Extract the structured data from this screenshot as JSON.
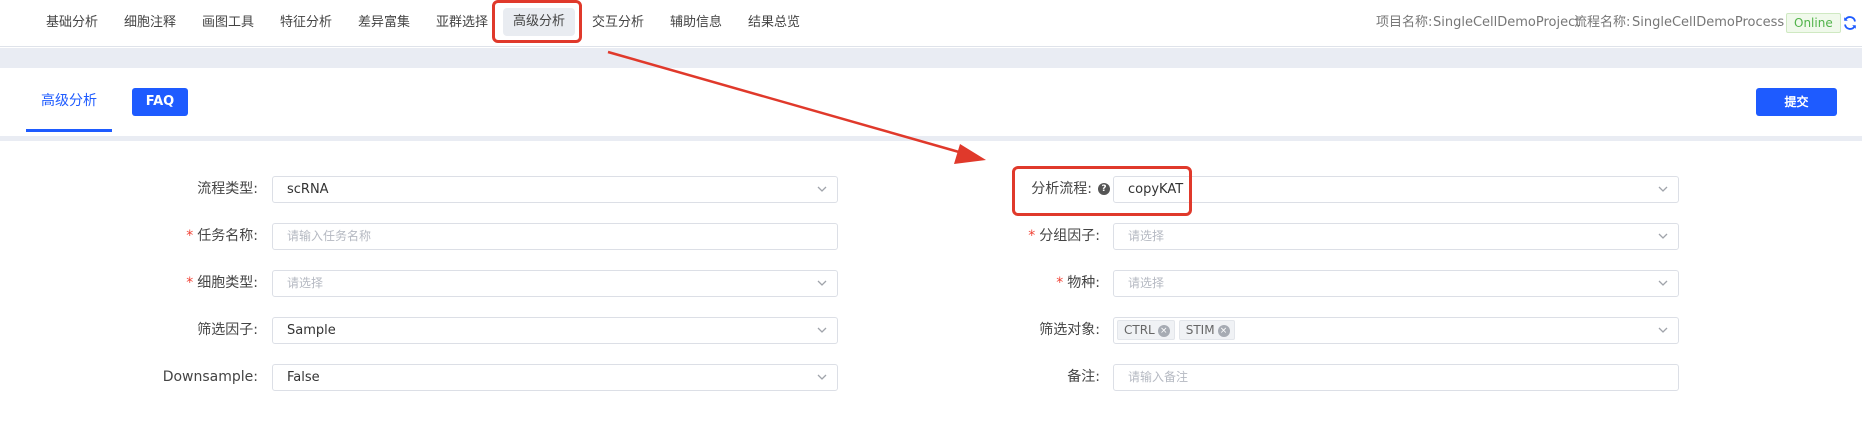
{
  "nav": {
    "items": [
      "基础分析",
      "细胞注释",
      "画图工具",
      "特征分析",
      "差异富集",
      "亚群选择",
      "高级分析",
      "交互分析",
      "辅助信息",
      "结果总览"
    ],
    "project_label": "项目名称:",
    "project_value": "SingleCellDemoProject",
    "process_label": "流程名称:",
    "process_value": "SingleCellDemoProcess",
    "status": "Online",
    "refresh_icon": "refresh-icon"
  },
  "tabs": {
    "active": "高级分析",
    "faq": "FAQ",
    "submit": "提交"
  },
  "form": {
    "left": [
      {
        "label": "流程类型:",
        "required": false,
        "value": "scRNA",
        "placeholder": "",
        "type": "select"
      },
      {
        "label": "任务名称:",
        "required": true,
        "value": "",
        "placeholder": "请输入任务名称",
        "type": "input"
      },
      {
        "label": "细胞类型:",
        "required": true,
        "value": "",
        "placeholder": "请选择",
        "type": "select"
      },
      {
        "label": "筛选因子:",
        "required": false,
        "value": "Sample",
        "placeholder": "",
        "type": "select"
      },
      {
        "label": "Downsample:",
        "required": false,
        "value": "False",
        "placeholder": "",
        "type": "select"
      }
    ],
    "right": [
      {
        "label": "分析流程:",
        "required": false,
        "value": "copyKAT",
        "placeholder": "",
        "type": "select",
        "help": true
      },
      {
        "label": "分组因子:",
        "required": true,
        "value": "",
        "placeholder": "请选择",
        "type": "select"
      },
      {
        "label": "物种:",
        "required": true,
        "value": "",
        "placeholder": "请选择",
        "type": "select"
      },
      {
        "label": "筛选对象:",
        "required": false,
        "tags": [
          "CTRL",
          "STIM"
        ],
        "type": "multiselect"
      },
      {
        "label": "备注:",
        "required": false,
        "value": "",
        "placeholder": "请输入备注",
        "type": "input"
      }
    ],
    "required_mark": "*"
  },
  "colors": {
    "accent": "#1e5bff",
    "annotation": "#e0392b",
    "online": "#51b34a"
  }
}
